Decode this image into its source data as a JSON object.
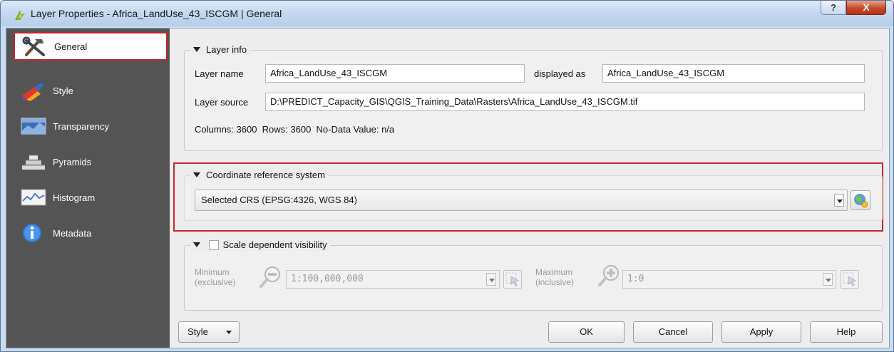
{
  "window": {
    "title": "Layer Properties - Africa_LandUse_43_ISCGM | General",
    "help_glyph": "?",
    "close_glyph": "X"
  },
  "sidebar": {
    "items": [
      {
        "label": "General",
        "icon": "hammer-tools-icon",
        "active": true
      },
      {
        "label": "Style",
        "icon": "paint-brush-icon",
        "active": false
      },
      {
        "label": "Transparency",
        "icon": "transparency-icon",
        "active": false
      },
      {
        "label": "Pyramids",
        "icon": "pyramids-icon",
        "active": false
      },
      {
        "label": "Histogram",
        "icon": "histogram-icon",
        "active": false
      },
      {
        "label": "Metadata",
        "icon": "info-icon",
        "active": false
      }
    ]
  },
  "layer_info": {
    "title": "Layer info",
    "layer_name_label": "Layer name",
    "layer_name_value": "Africa_LandUse_43_ISCGM",
    "displayed_as_label": "displayed as",
    "displayed_as_value": "Africa_LandUse_43_ISCGM",
    "layer_source_label": "Layer source",
    "layer_source_value": "D:\\PREDICT_Capacity_GIS\\QGIS_Training_Data\\Rasters\\Africa_LandUse_43_ISCGM.tif",
    "summary": "Columns: 3600  Rows: 3600  No-Data Value: n/a"
  },
  "crs": {
    "title": "Coordinate reference system",
    "selected": "Selected CRS (EPSG:4326, WGS 84)"
  },
  "scale": {
    "title": "Scale dependent visibility",
    "checked": false,
    "minimum_label_1": "Minimum",
    "minimum_label_2": "(exclusive)",
    "minimum_value": "1:100,000,000",
    "maximum_label_1": "Maximum",
    "maximum_label_2": "(inclusive)",
    "maximum_value": "1:0"
  },
  "footer": {
    "style_button": "Style",
    "ok": "OK",
    "cancel": "Cancel",
    "apply": "Apply",
    "help": "Help"
  },
  "colors": {
    "highlight": "#c0282c",
    "sidebar_bg": "#545454",
    "titlebar": "#c4d8ef"
  }
}
